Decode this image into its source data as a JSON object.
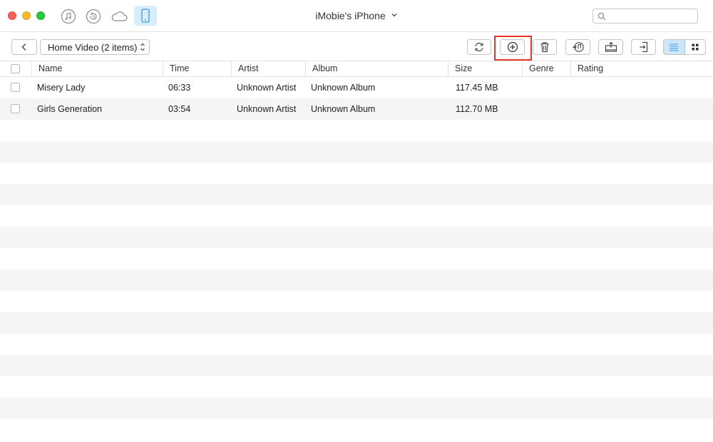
{
  "window": {
    "title": "iMobie's iPhone",
    "search": {
      "value": "",
      "placeholder": ""
    }
  },
  "nav": {
    "icons": [
      "music-icon",
      "restore-icon",
      "cloud-icon",
      "iphone-icon"
    ],
    "active": "iphone-icon"
  },
  "toolbar": {
    "category_select": "Home Video (2 items)",
    "actions": [
      "refresh",
      "add",
      "delete",
      "to-itunes",
      "to-computer",
      "to-device"
    ],
    "highlighted_action": "add",
    "view_mode": "list"
  },
  "table": {
    "columns": [
      "Name",
      "Time",
      "Artist",
      "Album",
      "Size",
      "Genre",
      "Rating"
    ],
    "rows": [
      {
        "name": "Misery Lady",
        "time": "06:33",
        "artist": "Unknown Artist",
        "album": "Unknown Album",
        "size": "117.45 MB",
        "genre": "",
        "rating": ""
      },
      {
        "name": "Girls Generation",
        "time": "03:54",
        "artist": "Unknown Artist",
        "album": "Unknown Album",
        "size": "112.70 MB",
        "genre": "",
        "rating": ""
      }
    ]
  },
  "colors": {
    "accent": "#3a9ad9",
    "highlight_box": "#e8342a",
    "row_stripe": "#f5f5f5"
  }
}
